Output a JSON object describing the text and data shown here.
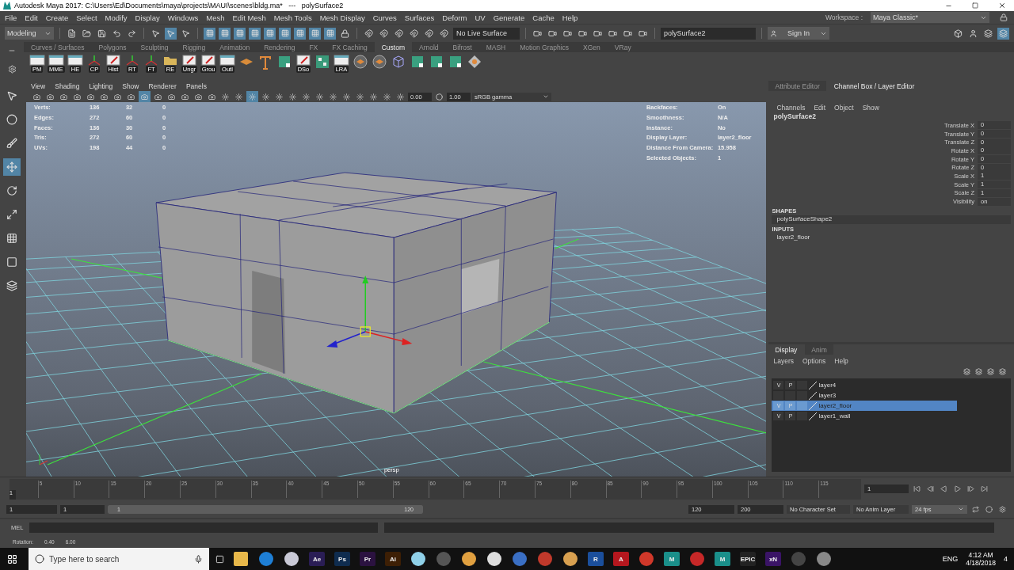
{
  "window": {
    "title": "Autodesk Maya 2017: C:\\Users\\Ed\\Documents\\maya\\projects\\MAUI\\scenes\\bldg.ma*   ---   polySurface2"
  },
  "menu": [
    "File",
    "Edit",
    "Create",
    "Select",
    "Modify",
    "Display",
    "Windows",
    "Mesh",
    "Edit Mesh",
    "Mesh Tools",
    "Mesh Display",
    "Curves",
    "Surfaces",
    "Deform",
    "UV",
    "Generate",
    "Cache",
    "Help"
  ],
  "status_line": {
    "mode": "Modeling",
    "live_surface": "No Live Surface",
    "object_field": "polySurface2",
    "sign_in": "Sign In",
    "workspace_label": "Workspace :",
    "workspace": "Maya Classic*"
  },
  "shelf_tabs": [
    {
      "label": "Curves / Surfaces",
      "selected": false
    },
    {
      "label": "Polygons",
      "selected": false
    },
    {
      "label": "Sculpting",
      "selected": false
    },
    {
      "label": "Rigging",
      "selected": false
    },
    {
      "label": "Animation",
      "selected": false
    },
    {
      "label": "Rendering",
      "selected": false
    },
    {
      "label": "FX",
      "selected": false
    },
    {
      "label": "FX Caching",
      "selected": false
    },
    {
      "label": "Custom",
      "selected": true
    },
    {
      "label": "Arnold",
      "selected": false
    },
    {
      "label": "Bifrost",
      "selected": false
    },
    {
      "label": "MASH",
      "selected": false
    },
    {
      "label": "Motion Graphics",
      "selected": false
    },
    {
      "label": "XGen",
      "selected": false
    },
    {
      "label": "VRay",
      "selected": false
    }
  ],
  "shelf_buttons": [
    {
      "kind": "window",
      "label": "PM"
    },
    {
      "kind": "window",
      "label": "MME"
    },
    {
      "kind": "window",
      "label": "HE"
    },
    {
      "kind": "axes",
      "label": "CP"
    },
    {
      "kind": "note",
      "label": "Hist"
    },
    {
      "kind": "axes",
      "label": "RT"
    },
    {
      "kind": "axes",
      "label": "FT"
    },
    {
      "kind": "folder",
      "label": "RE"
    },
    {
      "kind": "note",
      "label": "Ungr"
    },
    {
      "kind": "note",
      "label": "Grou"
    },
    {
      "kind": "window",
      "label": "Outl"
    },
    {
      "kind": "plane"
    },
    {
      "kind": "type"
    },
    {
      "kind": "square"
    },
    {
      "kind": "note",
      "label": "DSo"
    },
    {
      "kind": "checker"
    },
    {
      "kind": "window",
      "label": "LRA"
    },
    {
      "kind": "disc"
    },
    {
      "kind": "disc"
    },
    {
      "kind": "cube"
    },
    {
      "kind": "square"
    },
    {
      "kind": "square"
    },
    {
      "kind": "square"
    },
    {
      "kind": "diamond"
    }
  ],
  "viewport": {
    "menu": [
      "View",
      "Shading",
      "Lighting",
      "Show",
      "Renderer",
      "Panels"
    ],
    "exposure": "0.00",
    "gamma": "1.00",
    "color_space": "sRGB gamma",
    "hud_stats": [
      {
        "label": "Verts:",
        "values": [
          "136",
          "32",
          "0"
        ]
      },
      {
        "label": "Edges:",
        "values": [
          "272",
          "60",
          "0"
        ]
      },
      {
        "label": "Faces:",
        "values": [
          "136",
          "30",
          "0"
        ]
      },
      {
        "label": "Tris:",
        "values": [
          "272",
          "60",
          "0"
        ]
      },
      {
        "label": "UVs:",
        "values": [
          "198",
          "44",
          "0"
        ]
      }
    ],
    "hud_info": [
      {
        "label": "Backfaces:",
        "value": "On"
      },
      {
        "label": "Smoothness:",
        "value": "N/A"
      },
      {
        "label": "Instance:",
        "value": "No"
      },
      {
        "label": "Display Layer:",
        "value": "layer2_floor"
      },
      {
        "label": "Distance From Camera:",
        "value": "15.958"
      },
      {
        "label": "Selected Objects:",
        "value": "1"
      }
    ],
    "camera": "persp"
  },
  "channel_box": {
    "tabs": [
      {
        "label": "Attribute Editor",
        "selected": false
      },
      {
        "label": "Channel Box / Layer Editor",
        "selected": true
      }
    ],
    "menu": [
      "Channels",
      "Edit",
      "Object",
      "Show"
    ],
    "object": "polySurface2",
    "channels": [
      {
        "name": "Translate X",
        "value": "0"
      },
      {
        "name": "Translate Y",
        "value": "0"
      },
      {
        "name": "Translate Z",
        "value": "0"
      },
      {
        "name": "Rotate X",
        "value": "0"
      },
      {
        "name": "Rotate Y",
        "value": "0"
      },
      {
        "name": "Rotate Z",
        "value": "0"
      },
      {
        "name": "Scale X",
        "value": "1"
      },
      {
        "name": "Scale Y",
        "value": "1"
      },
      {
        "name": "Scale Z",
        "value": "1"
      },
      {
        "name": "Visibility",
        "value": "on"
      }
    ],
    "shapes_header": "SHAPES",
    "shape": "polySurfaceShape2",
    "inputs_header": "INPUTS",
    "input": "layer2_floor"
  },
  "layer_editor": {
    "tabs": [
      {
        "label": "Display",
        "selected": true
      },
      {
        "label": "Anim",
        "selected": false
      }
    ],
    "menu": [
      "Layers",
      "Options",
      "Help"
    ],
    "layers": [
      {
        "name": "layer4",
        "v": "V",
        "p": "P",
        "selected": false
      },
      {
        "name": "layer3",
        "selected": false
      },
      {
        "name": "layer2_floor",
        "v": "V",
        "p": "P",
        "selected": true
      },
      {
        "name": "layer1_wall",
        "v": "V",
        "p": "P",
        "selected": false
      }
    ]
  },
  "timeline": {
    "level": 0,
    "ticks": [
      "5",
      "10",
      "15",
      "20",
      "25",
      "30",
      "35",
      "40",
      "45",
      "50",
      "55",
      "60",
      "65",
      "70",
      "75",
      "80",
      "85",
      "90",
      "95",
      "100",
      "105",
      "110",
      "115"
    ],
    "current": "1",
    "current_field": "1"
  },
  "range": {
    "level": 1,
    "start": "1",
    "playback_start": "1",
    "slider_start": "1",
    "slider_end": "120",
    "playback_end": "120",
    "end": "200",
    "character_set": "No Character Set",
    "anim_layer": "No Anim Layer",
    "fps": "24 fps"
  },
  "command_line": {
    "label": "MEL"
  },
  "help_line": {
    "label": "Rotation:",
    "values": [
      "0.40",
      "6.00"
    ]
  },
  "taskbar": {
    "search_placeholder": "Type here to search",
    "apps": [
      {
        "kind": "folder",
        "color": "#e8b84a"
      },
      {
        "kind": "edge",
        "color": "#1e7fd6"
      },
      {
        "kind": "round",
        "color": "#c9c9d6"
      },
      {
        "kind": "tile",
        "label": "Ae",
        "color": "#2a1d55"
      },
      {
        "kind": "tile",
        "label": "Ps",
        "color": "#0f2c4f"
      },
      {
        "kind": "tile",
        "label": "Pr",
        "color": "#2b1240"
      },
      {
        "kind": "tile",
        "label": "Ai",
        "color": "#3d1f05"
      },
      {
        "kind": "round",
        "color": "#8fd0e8"
      },
      {
        "kind": "round",
        "color": "#555555"
      },
      {
        "kind": "round",
        "color": "#e0a040"
      },
      {
        "kind": "round",
        "color": "#dddddd"
      },
      {
        "kind": "round",
        "color": "#3a6fc4"
      },
      {
        "kind": "round",
        "color": "#c0392b"
      },
      {
        "kind": "round",
        "color": "#d8a050"
      },
      {
        "kind": "tile",
        "label": "R",
        "color": "#1b4f9c"
      },
      {
        "kind": "tile",
        "label": "A",
        "color": "#b5171e"
      },
      {
        "kind": "round",
        "color": "#d0382a"
      },
      {
        "kind": "tile",
        "label": "M",
        "color": "#1a8f8a"
      },
      {
        "kind": "round",
        "color": "#c62828"
      },
      {
        "kind": "tile",
        "label": "M",
        "color": "#1a8f8a"
      },
      {
        "kind": "tile",
        "label": "EPIC",
        "color": "#222222"
      },
      {
        "kind": "tile",
        "label": "xN",
        "color": "#3a1466"
      },
      {
        "kind": "round",
        "color": "#444444"
      },
      {
        "kind": "round",
        "color": "#888888"
      }
    ],
    "language": "ENG",
    "time": "4:12 AM",
    "date": "4/18/2018",
    "notifications": "4"
  }
}
